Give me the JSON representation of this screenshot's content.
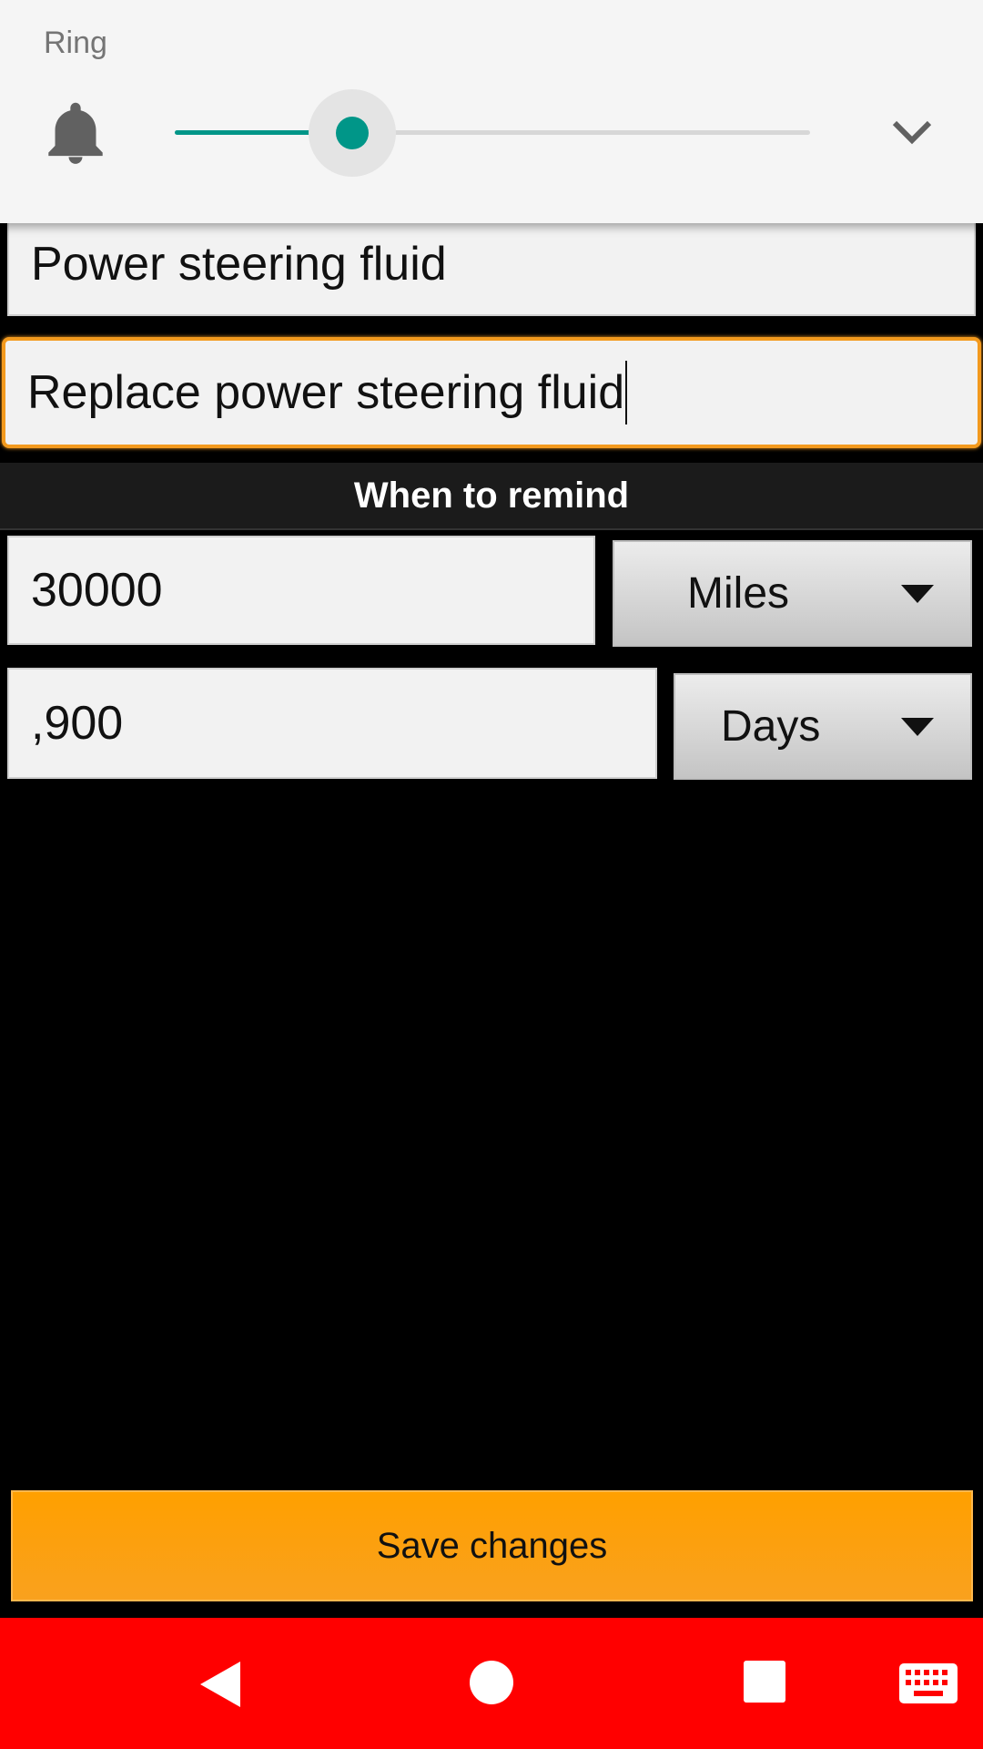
{
  "volume_panel": {
    "label": "Ring",
    "level_percent": 28,
    "icons": {
      "ringer": "bell-icon",
      "expand": "chevron-down-icon"
    },
    "colors": {
      "accent": "#009688",
      "background": "#f5f5f5"
    }
  },
  "form": {
    "name_value": "Power steering fluid",
    "description_value": "Replace power steering fluid",
    "section_title": "When to remind",
    "distance": {
      "value": "30000",
      "unit": "Miles"
    },
    "time": {
      "value": ",900",
      "unit": "Days"
    },
    "save_label": "Save changes",
    "colors": {
      "focus": "#f39a1e",
      "save": "#ffa000"
    }
  },
  "nav_bar": {
    "color": "#ff0000",
    "icons": [
      "back-icon",
      "home-icon",
      "recents-icon",
      "keyboard-icon"
    ]
  }
}
